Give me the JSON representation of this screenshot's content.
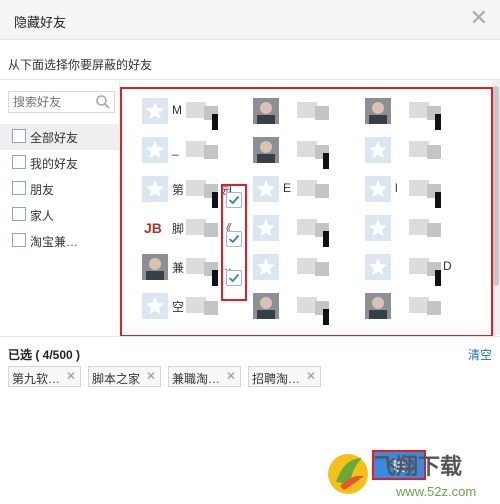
{
  "dialog": {
    "title": "隐藏好友",
    "subtitle": "从下面选择你要屏蔽的好友"
  },
  "search": {
    "placeholder": "搜索好友"
  },
  "groups": [
    {
      "label": "全部好友",
      "checked": false,
      "active": true
    },
    {
      "label": "我的好友",
      "checked": false,
      "active": false
    },
    {
      "label": "朋友",
      "checked": false,
      "active": false
    },
    {
      "label": "家人",
      "checked": false,
      "active": false
    },
    {
      "label": "淘宝兼…",
      "checked": false,
      "active": false
    }
  ],
  "friends": [
    {
      "name": "M",
      "avatar": "default-avatar-icon",
      "checked": false
    },
    {
      "name": "",
      "avatar": "photo-avatar",
      "checked": false
    },
    {
      "name": "",
      "avatar": "photo-avatar",
      "checked": false
    },
    {
      "name": "_",
      "avatar": "default-avatar-icon",
      "checked": false
    },
    {
      "name": "",
      "avatar": "photo-avatar",
      "checked": false
    },
    {
      "name": "",
      "avatar": "default-avatar-icon",
      "checked": false
    },
    {
      "name": "第",
      "name_suffix": "园",
      "avatar": "default-avatar-icon",
      "checked": true
    },
    {
      "name": "E",
      "avatar": "default-avatar-icon",
      "checked": false
    },
    {
      "name": "l",
      "avatar": "default-avatar-icon",
      "checked": false
    },
    {
      "name": "脚",
      "name_suffix": "《",
      "avatar": "jb-logo-avatar",
      "checked": true
    },
    {
      "name": "",
      "avatar": "default-avatar-icon",
      "checked": false
    },
    {
      "name": "",
      "avatar": "default-avatar-icon",
      "checked": false
    },
    {
      "name": "兼",
      "name_suffix": "…",
      "avatar": "photo-avatar",
      "checked": true
    },
    {
      "name": "",
      "avatar": "default-avatar-icon",
      "checked": false
    },
    {
      "name": "",
      "name_suffix": "D",
      "avatar": "default-avatar-icon",
      "checked": false
    },
    {
      "name": "空",
      "avatar": "default-avatar-icon",
      "checked": false
    },
    {
      "name": "",
      "avatar": "photo-avatar",
      "checked": false
    },
    {
      "name": "",
      "avatar": "photo-avatar",
      "checked": false
    }
  ],
  "selected": {
    "label": "已选 ( 4/500 )",
    "clear_label": "清空",
    "chips": [
      "第九软…",
      "脚本之家",
      "兼職淘…",
      "招聘淘…"
    ]
  },
  "confirm_button": {
    "label": "确"
  },
  "watermark": {
    "title": "飞翔下载",
    "url": "www.52z.com"
  },
  "colors": {
    "accent": "#3a8be0",
    "highlight": "#e02020",
    "link": "#1e6fd0",
    "check": "#2a7fd4"
  }
}
